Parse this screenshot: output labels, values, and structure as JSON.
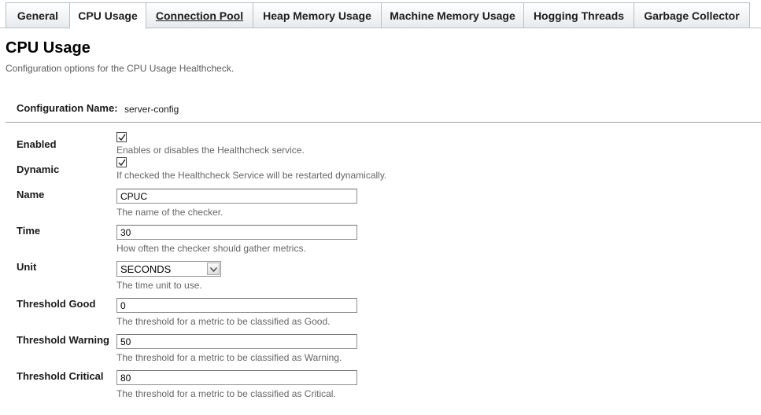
{
  "tabs": [
    {
      "label": "General"
    },
    {
      "label": "CPU Usage"
    },
    {
      "label": "Connection Pool"
    },
    {
      "label": "Heap Memory Usage"
    },
    {
      "label": "Machine Memory Usage"
    },
    {
      "label": "Hogging Threads"
    },
    {
      "label": "Garbage Collector"
    }
  ],
  "page": {
    "title": "CPU Usage",
    "description": "Configuration options for the CPU Usage Healthcheck."
  },
  "config": {
    "label": "Configuration Name:",
    "value": "server-config"
  },
  "fields": {
    "enabled": {
      "label": "Enabled",
      "checked": true,
      "help": "Enables or disables the Healthcheck service."
    },
    "dynamic": {
      "label": "Dynamic",
      "checked": true,
      "help": "If checked the Healthcheck Service will be restarted dynamically."
    },
    "name": {
      "label": "Name",
      "value": "CPUC",
      "help": "The name of the checker."
    },
    "time": {
      "label": "Time",
      "value": "30",
      "help": "How often the checker should gather metrics."
    },
    "unit": {
      "label": "Unit",
      "value": "SECONDS",
      "help": "The time unit to use."
    },
    "threshold_good": {
      "label": "Threshold Good",
      "value": "0",
      "help": "The threshold for a metric to be classified as Good."
    },
    "threshold_warning": {
      "label": "Threshold Warning",
      "value": "50",
      "help": "The threshold for a metric to be classified as Warning."
    },
    "threshold_critical": {
      "label": "Threshold Critical",
      "value": "80",
      "help": "The threshold for a metric to be classified as Critical."
    }
  }
}
